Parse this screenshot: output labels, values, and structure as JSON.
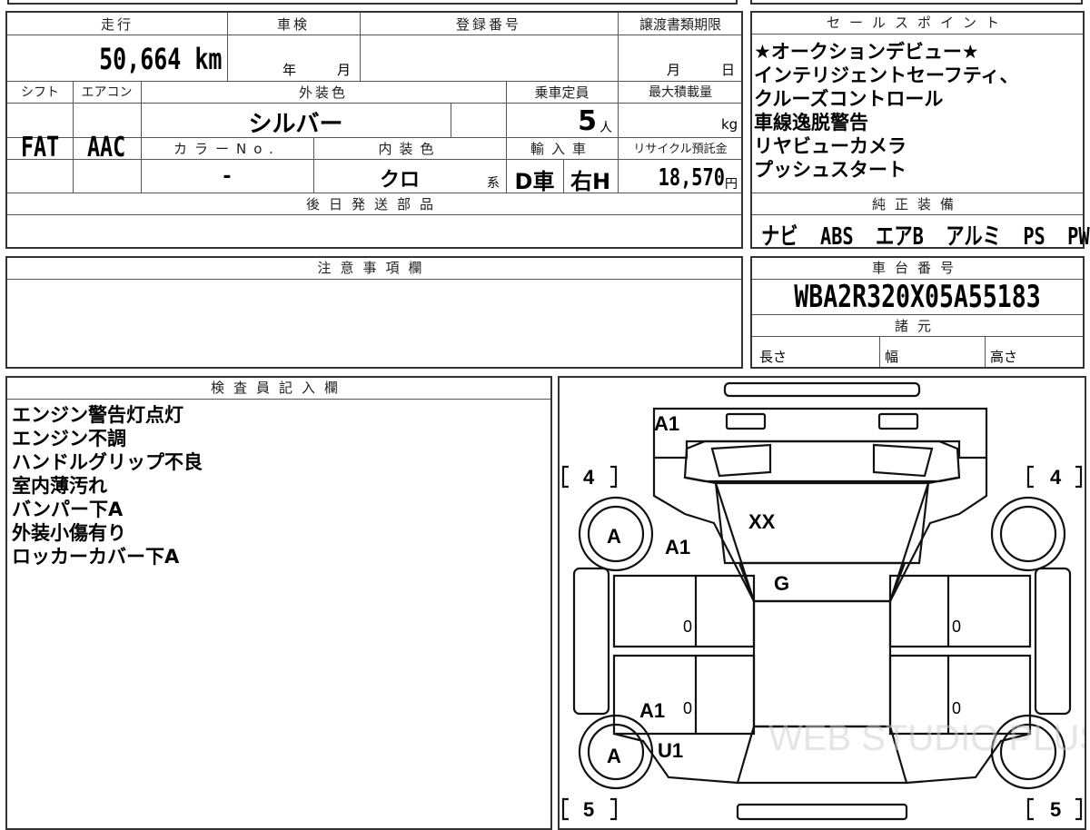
{
  "main_table": {
    "headers": {
      "mileage": "走行",
      "inspection": "車検",
      "registration": "登録番号",
      "transfer_deadline": "譲渡書類期限",
      "shift": "シフト",
      "aircon": "エアコン",
      "exterior_color": "外装色",
      "capacity": "乗車定員",
      "max_load": "最大積載量",
      "color_no": "カラーNo.",
      "interior_color": "内装色",
      "import": "輸入車",
      "recycle_fee": "リサイクル預託金"
    },
    "mileage_value": "50,664 km",
    "inspection_year_unit": "年",
    "inspection_month_unit": "月",
    "transfer_month_unit": "月",
    "transfer_day_unit": "日",
    "shift_value": "FAT",
    "aircon_value": "AAC",
    "exterior_color_value": "シルバー",
    "capacity_value": "5",
    "capacity_unit": "人",
    "max_load_unit": "kg",
    "color_no_value": "-",
    "interior_color_value": "クロ",
    "interior_color_suffix": "系",
    "import_type": "D車",
    "steering": "右H",
    "recycle_value": "18,570",
    "recycle_unit": "円"
  },
  "later_parts": {
    "header": "後日発送部品",
    "value": ""
  },
  "sales_points": {
    "header": "セールスポイント",
    "lines": [
      "★オークションデビュー★",
      "インテリジェントセーフティ、",
      "クルーズコントロール",
      "車線逸脱警告",
      "リヤビューカメラ",
      "プッシュスタート"
    ]
  },
  "factory_equipment": {
    "header": "純正装備",
    "items": [
      "ナビ",
      "ABS",
      "エアB",
      "アルミ",
      "PS",
      "PW"
    ]
  },
  "caution": {
    "header": "注意事項欄",
    "value": ""
  },
  "chassis": {
    "header": "車台番号",
    "value": "WBA2R320X05A55183"
  },
  "specs": {
    "header": "諸元",
    "length": "長さ",
    "width": "幅",
    "height": "高さ"
  },
  "inspector": {
    "header": "検査員記入欄",
    "notes": [
      "エンジン警告灯点灯",
      "エンジン不調",
      "ハンドルグリップ不良",
      "室内薄汚れ",
      "バンパー下A",
      "外装小傷有り",
      "ロッカーカバー下A"
    ]
  },
  "diagram": {
    "marks": {
      "front_bumper": "A1",
      "windshield": "XX",
      "front_left_fender": "A1",
      "roof": "G",
      "front_left_wheel": "A",
      "rear_left_door": "A1",
      "rear_left_quarter": "U1",
      "rear_left_wheel": "A",
      "front_left_door_zero": "0",
      "rear_left_door_zero": "0",
      "front_right_door_zero": "0",
      "rear_right_door_zero": "0"
    },
    "tires": {
      "front_left": "4",
      "front_right": "4",
      "rear_left": "5",
      "rear_right": "5"
    },
    "watermark": "WEB STUDIO PLUS"
  }
}
